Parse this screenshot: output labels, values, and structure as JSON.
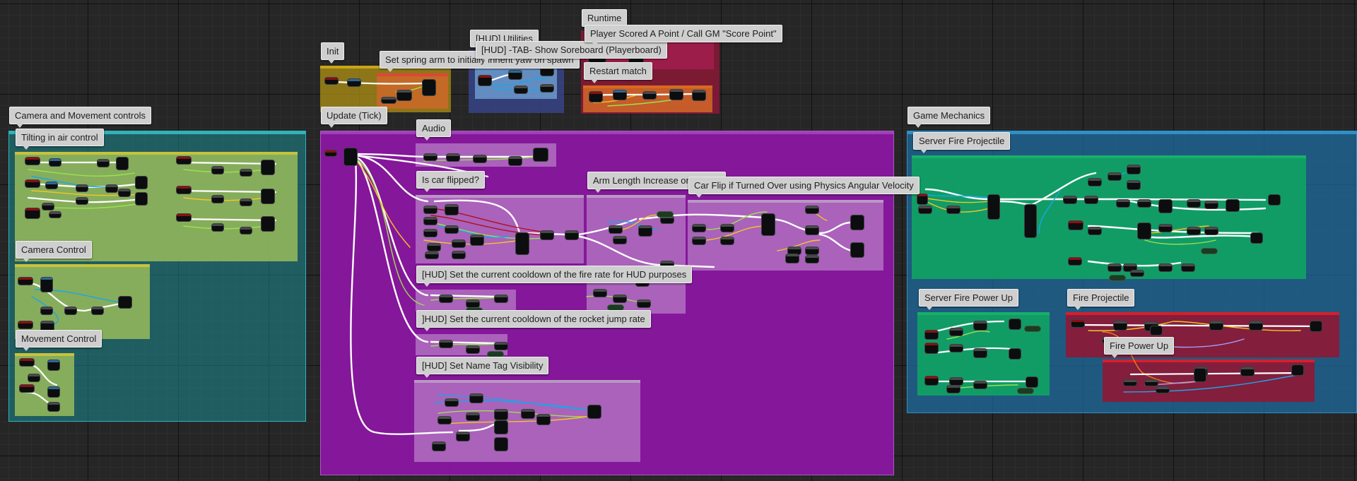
{
  "comments": {
    "camera_movement": "Camera and Movement controls",
    "tilting": "Tilting in air control",
    "camera_control": "Camera Control",
    "movement_control": "Movement Control",
    "init": "Init",
    "spring_arm": "Set spring arm to initially inherit yaw on spawn",
    "hud_utilities": "[HUD] Utilities",
    "scoreboard": "[HUD] -TAB- Show Soreboard (Playerboard)",
    "runtime": "Runtime",
    "player_scored": "Player Scored A Point / Call GM \"Score Point\"",
    "restart_match": "Restart match",
    "update_tick": "Update (Tick)",
    "audio": "Audio",
    "car_flipped": "Is car flipped?",
    "arm_length": "Arm Length Increase on Speed",
    "car_flip": "Car Flip if Turned Over using Physics Angular Velocity",
    "cooldown_fire": "[HUD] Set the current cooldown of the fire rate for HUD purposes",
    "cooldown_rocket": "]HUD] Set the current cooldown of the rocket jump rate",
    "name_tag": "[HUD] Set Name Tag Visibility",
    "game_mechanics": "Game Mechanics",
    "server_fire_projectile": "Server Fire Projectile",
    "server_fire_power_up": "Server Fire Power Up",
    "fire_projectile": "Fire Projectile",
    "fire_power_up": "Fire Power Up"
  },
  "colors": {
    "teal_group": "#1a8a91",
    "olive": "#a4c45a",
    "purple": "#8a16a0",
    "steel_blue": "#1d6fa5",
    "green": "#10a563",
    "crimson": "#a6163f",
    "wire_exec": "#ffffff",
    "wire_float": "#9be14f",
    "wire_object": "#1aa6e8",
    "wire_bool": "#b0101a",
    "wire_vector": "#f2c624"
  }
}
